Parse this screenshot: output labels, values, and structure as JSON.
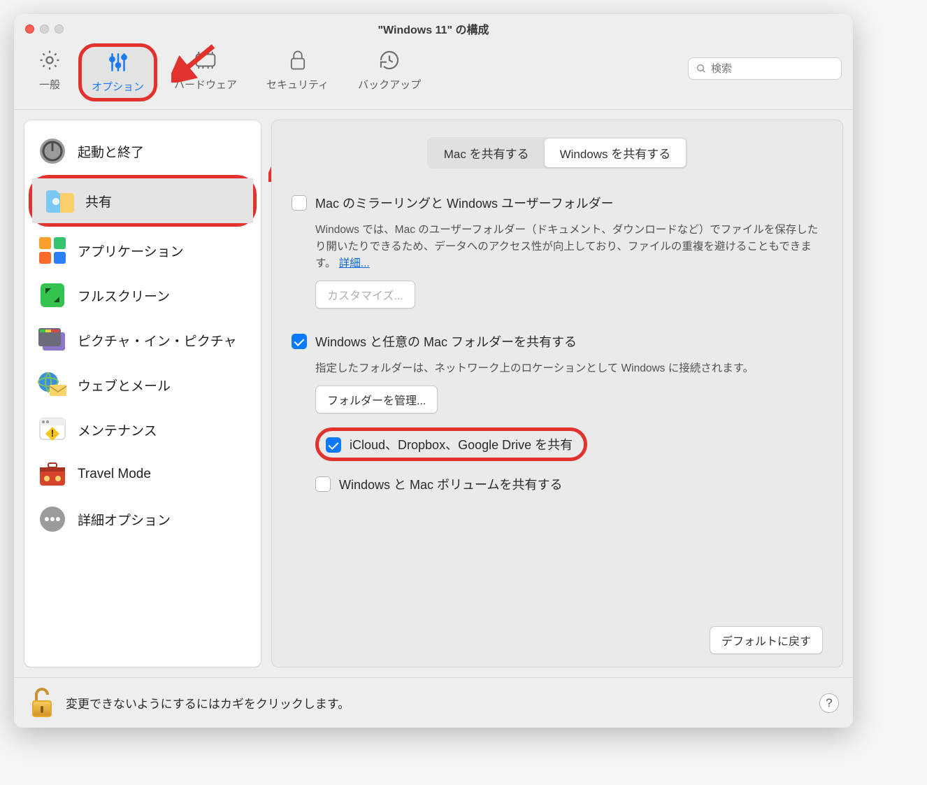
{
  "window": {
    "title": "\"Windows 11\" の構成"
  },
  "toolbar": {
    "general": "一般",
    "options": "オプション",
    "hardware": "ハードウェア",
    "security": "セキュリティ",
    "backup": "バックアップ",
    "search_placeholder": "検索"
  },
  "sidebar": {
    "items": [
      {
        "label": "起動と終了"
      },
      {
        "label": "共有"
      },
      {
        "label": "アプリケーション"
      },
      {
        "label": "フルスクリーン"
      },
      {
        "label": "ピクチャ・イン・ピクチャ"
      },
      {
        "label": "ウェブとメール"
      },
      {
        "label": "メンテナンス"
      },
      {
        "label": "Travel Mode"
      },
      {
        "label": "詳細オプション"
      }
    ]
  },
  "content": {
    "segment_mac": "Mac を共有する",
    "segment_windows": "Windows を共有する",
    "mirror_title": "Mac のミラーリングと Windows ユーザーフォルダー",
    "mirror_desc": "Windows では、Mac のユーザーフォルダー（ドキュメント、ダウンロードなど）でファイルを保存したり開いたりできるため、データへのアクセス性が向上しており、ファイルの重複を避けることもできます。",
    "mirror_link": "詳細...",
    "customize_btn": "カスタマイズ...",
    "share_folders_title": "Windows と任意の Mac フォルダーを共有する",
    "share_folders_desc": "指定したフォルダーは、ネットワーク上のロケーションとして Windows に接続されます。",
    "manage_folders_btn": "フォルダーを管理...",
    "cloud_share_label": "iCloud、Dropbox、Google Drive を共有",
    "volumes_share_label": "Windows と Mac ボリュームを共有する",
    "defaults_btn": "デフォルトに戻す"
  },
  "footer": {
    "lock_text": "変更できないようにするにはカギをクリックします。"
  }
}
